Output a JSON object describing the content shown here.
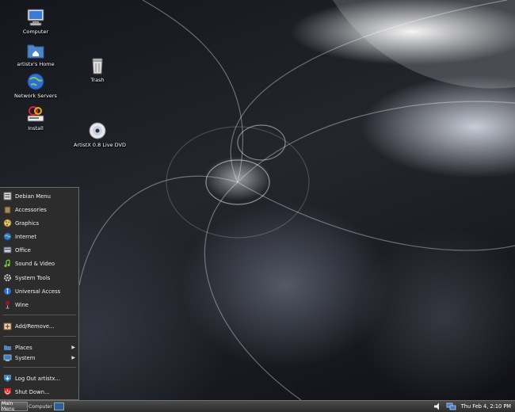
{
  "desktop": {
    "icons": [
      {
        "label": "Computer",
        "icon": "computer-icon"
      },
      {
        "label": "artistx's Home",
        "icon": "home-folder-icon"
      },
      {
        "label": "Network Servers",
        "icon": "network-globe-icon"
      },
      {
        "label": "Install",
        "icon": "install-icon"
      },
      {
        "label": "Trash",
        "icon": "trash-icon"
      },
      {
        "label": "ArtistX 0.8 Live DVD",
        "icon": "dvd-icon"
      }
    ]
  },
  "menu": {
    "items": [
      {
        "label": "Debian Menu",
        "icon": "debian-menu-icon"
      },
      {
        "label": "Accessories",
        "icon": "accessories-icon"
      },
      {
        "label": "Graphics",
        "icon": "graphics-icon"
      },
      {
        "label": "Internet",
        "icon": "internet-icon"
      },
      {
        "label": "Office",
        "icon": "office-icon"
      },
      {
        "label": "Sound & Video",
        "icon": "sound-video-icon"
      },
      {
        "label": "System Tools",
        "icon": "system-tools-icon"
      },
      {
        "label": "Universal Access",
        "icon": "universal-access-icon"
      },
      {
        "label": "Wine",
        "icon": "wine-icon"
      }
    ],
    "add_remove": "Add/Remove...",
    "places": "Places",
    "system": "System",
    "logout": "Log Out artistx...",
    "shutdown": "Shut Down..."
  },
  "taskbar": {
    "menu_button": "Main Menu",
    "task": "Computer",
    "clock": "Thu Feb  4,  2:10 PM"
  },
  "colors": {
    "accent": "#2f5d99",
    "menu_bg": "#2c2c2c"
  }
}
